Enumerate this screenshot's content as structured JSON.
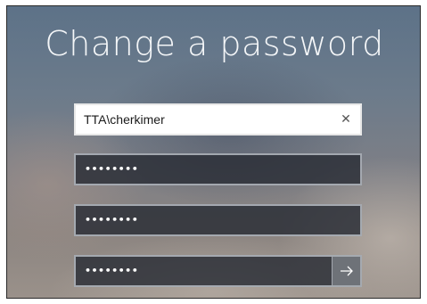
{
  "title": "Change a password",
  "fields": {
    "username": {
      "value": "TTA\\cherkimer",
      "clear_icon": "close-icon"
    },
    "old_password": {
      "masked_value": "••••••••"
    },
    "new_password": {
      "masked_value": "••••••••"
    },
    "confirm_password": {
      "masked_value": "••••••••",
      "submit_icon": "arrow-right-icon"
    }
  },
  "colors": {
    "title_text": "#f4f6f8",
    "input_dark_bg": "#2c3038",
    "input_border": "#c8cdd4",
    "username_bg": "#ffffff"
  }
}
